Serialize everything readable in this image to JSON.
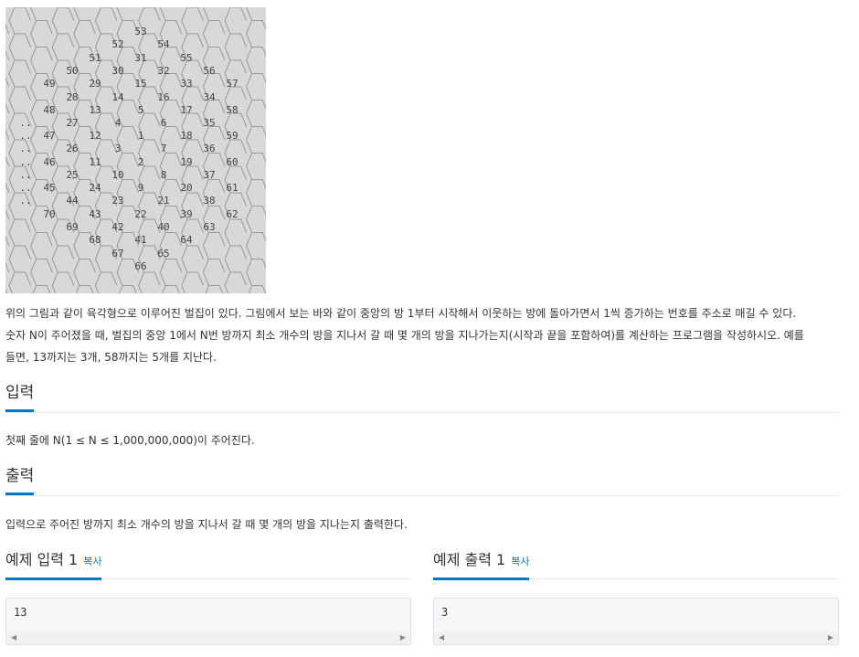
{
  "figure": {
    "numbers": [
      "53",
      "52",
      "54",
      "51",
      "31",
      "55",
      "50",
      "30",
      "32",
      "56",
      "49",
      "29",
      "15",
      "33",
      "57",
      "28",
      "14",
      "16",
      "34",
      "48",
      "13",
      "5",
      "17",
      "58",
      "..",
      "27",
      "4",
      "6",
      "35",
      "..",
      "47",
      "12",
      "1",
      "18",
      "59",
      "..",
      "26",
      "3",
      "7",
      "36",
      "..",
      "46",
      "11",
      "2",
      "19",
      "60",
      "..",
      "25",
      "10",
      "8",
      "37",
      "..",
      "45",
      "24",
      "9",
      "20",
      "61",
      "..",
      "44",
      "23",
      "21",
      "38",
      "70",
      "43",
      "22",
      "39",
      "62",
      "69",
      "42",
      "40",
      "63",
      "68",
      "41",
      "64",
      "67",
      "65",
      "66"
    ]
  },
  "problem": {
    "line1": "위의 그림과 같이 육각형으로 이루어진 벌집이 있다. 그림에서 보는 바와 같이 중앙의 방 1부터 시작해서 이웃하는 방에 돌아가면서 1씩 증가하는 번호를 주소로 매길 수 있다.",
    "line2": "숫자 N이 주어졌을 때, 벌집의 중앙 1에서 N번 방까지 최소 개수의 방을 지나서 갈 때 몇 개의 방을 지나가는지(시작과 끝을 포함하여)를 계산하는 프로그램을 작성하시오. 예를",
    "line3": "들면, 13까지는 3개, 58까지는 5개를 지난다."
  },
  "input": {
    "heading": "입력",
    "text": "첫째 줄에 N(1 ≤ N ≤ 1,000,000,000)이 주어진다."
  },
  "output": {
    "heading": "출력",
    "text": "입력으로 주어진 방까지 최소 개수의 방을 지나서 갈 때 몇 개의 방을 지나는지 출력한다."
  },
  "examples": {
    "copy_label": "복사",
    "input_title": "예제 입력 1",
    "input_value": "13",
    "output_title": "예제 출력 1",
    "output_value": "3"
  }
}
